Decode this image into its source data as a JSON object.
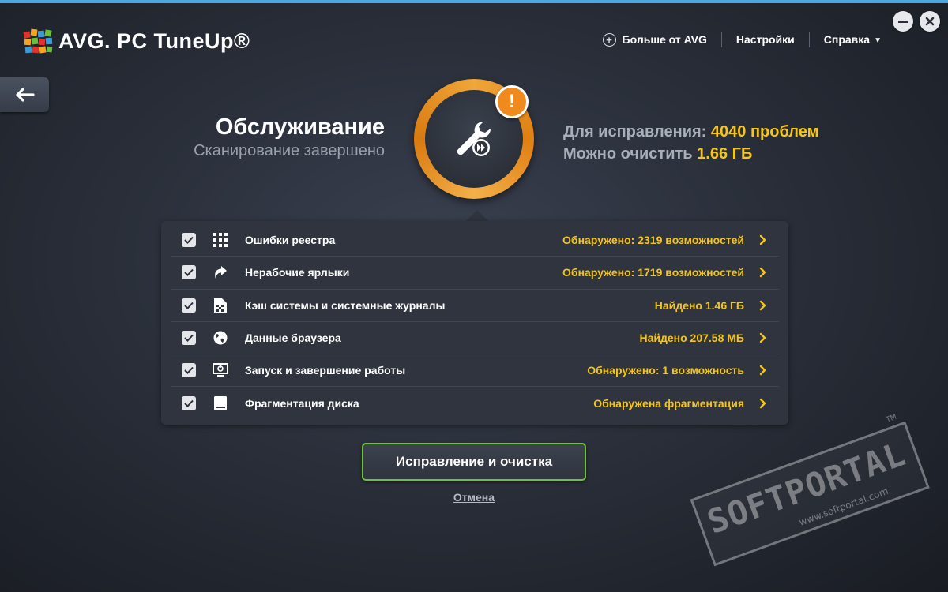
{
  "app": {
    "title": "AVG. PC TuneUp®"
  },
  "topnav": {
    "more": "Больше от AVG",
    "settings": "Настройки",
    "help": "Справка",
    "help_caret": "▼"
  },
  "header": {
    "title": "Обслуживание",
    "subtitle": "Сканирование завершено",
    "fix_label": "Для исправления:",
    "fix_value": "4040 проблем",
    "clean_label": "Можно очистить",
    "clean_value": "1.66 ГБ",
    "alert_glyph": "!"
  },
  "items": [
    {
      "label": "Ошибки реестра",
      "status": "Обнаружено: 2319 возможностей",
      "icon": "registry-grid-icon",
      "checked": true
    },
    {
      "label": "Нерабочие ярлыки",
      "status": "Обнаружено: 1719 возможностей",
      "icon": "shortcut-arrow-icon",
      "checked": true
    },
    {
      "label": "Кэш системы и системные журналы",
      "status": "Найдено 1.46 ГБ",
      "icon": "cache-file-icon",
      "checked": true
    },
    {
      "label": "Данные браузера",
      "status": "Найдено 207.58 МБ",
      "icon": "globe-icon",
      "checked": true
    },
    {
      "label": "Запуск и завершение работы",
      "status": "Обнаружено: 1 возможность",
      "icon": "monitor-icon",
      "checked": true
    },
    {
      "label": "Фрагментация диска",
      "status": "Обнаружена фрагментация",
      "icon": "disk-icon",
      "checked": true
    }
  ],
  "actions": {
    "fix_button": "Исправление и очистка",
    "cancel": "Отмена"
  },
  "watermark": {
    "brand": "SOFTPORTAL",
    "url": "www.softportal.com",
    "tm": "TM"
  },
  "colors": {
    "accent_orange": "#f08a1c",
    "highlight_yellow": "#f5c518",
    "button_border_green": "#6cc23a",
    "top_line_blue": "#4aa9e0"
  }
}
